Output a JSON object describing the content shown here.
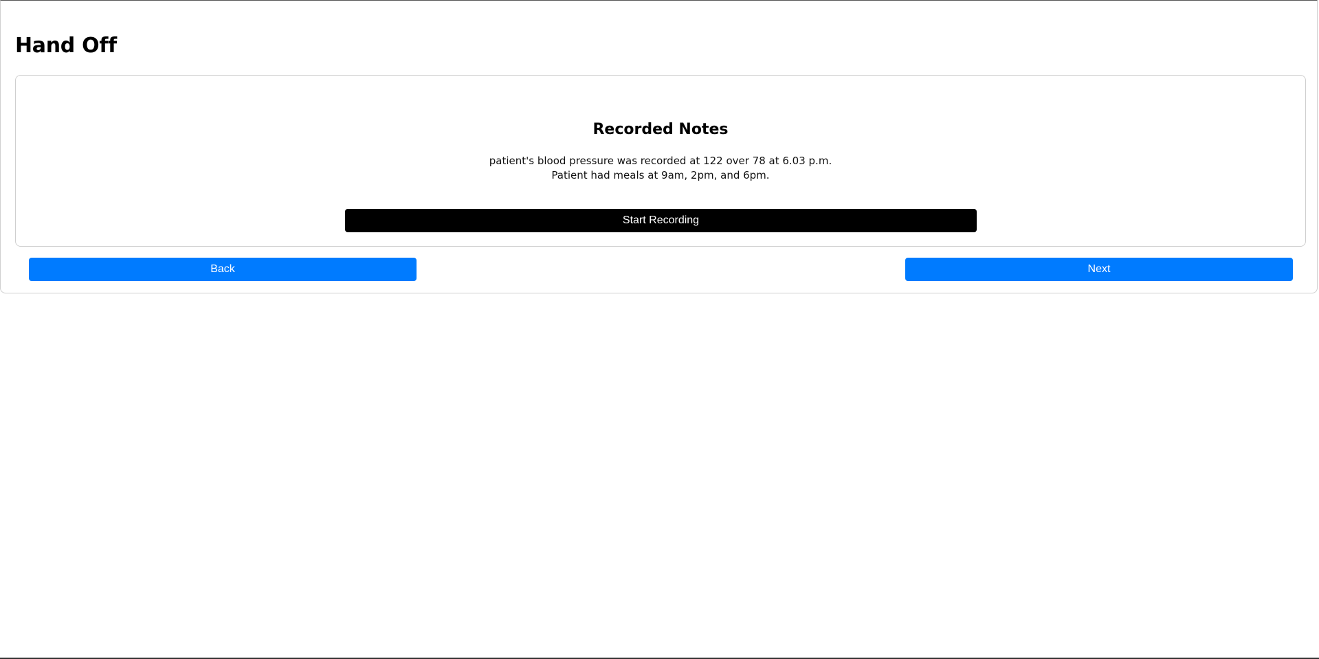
{
  "page": {
    "title": "Hand Off"
  },
  "notes_card": {
    "title": "Recorded Notes",
    "lines": [
      "patient's blood pressure was recorded at 122 over 78 at 6.03 p.m.",
      "Patient had meals at 9am, 2pm, and 6pm."
    ],
    "record_button_label": "Start Recording"
  },
  "navigation": {
    "back_label": "Back",
    "next_label": "Next"
  },
  "colors": {
    "primary": "#007bff",
    "record_button": "#000000",
    "border": "#cfcfcf"
  }
}
